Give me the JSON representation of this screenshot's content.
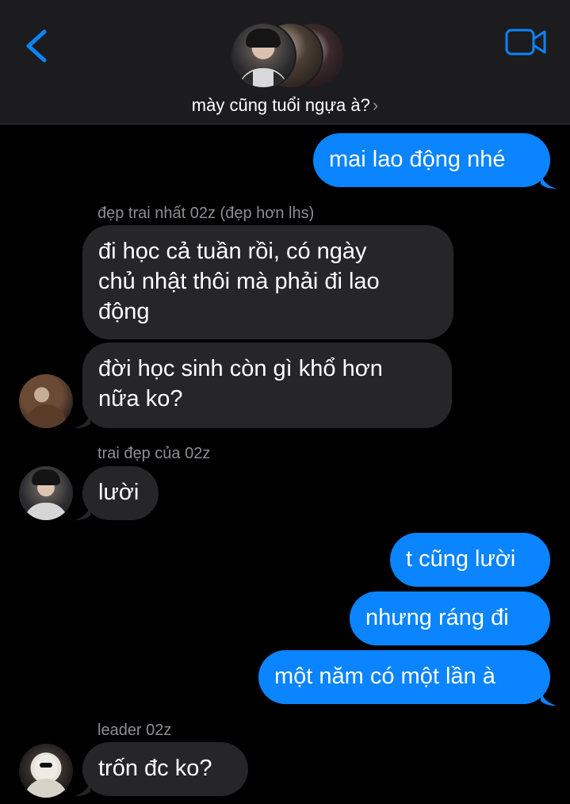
{
  "header": {
    "title": "mày cũng tuổi ngựa à?",
    "title_chevron": "›",
    "back_icon": "chevron-left-icon",
    "video_icon": "video-camera-icon",
    "accent_color": "#0a84ff"
  },
  "messages": [
    {
      "direction": "outgoing",
      "text": "mai lao động nhé"
    },
    {
      "sender": "đẹp trai nhất 02z (đẹp hơn lhs)"
    },
    {
      "direction": "incoming",
      "lines": [
        "đi học cả tuần rồi, có ngày",
        "chủ nhật thôi mà phải đi lao",
        "động"
      ]
    },
    {
      "direction": "incoming",
      "lines": [
        "đời học sinh còn gì khổ hơn",
        "nữa ko?"
      ]
    },
    {
      "sender": "trai đẹp của 02z"
    },
    {
      "direction": "incoming",
      "text": "lười"
    },
    {
      "direction": "outgoing",
      "text": "t cũng lười"
    },
    {
      "direction": "outgoing",
      "text": "nhưng ráng đi"
    },
    {
      "direction": "outgoing",
      "text": "một năm có một lần à"
    },
    {
      "sender": "leader 02z"
    },
    {
      "direction": "incoming",
      "text": "trốn đc ko?"
    }
  ],
  "colors": {
    "outgoing_bubble": "#0a84ff",
    "incoming_bubble": "#262628",
    "header_bg": "#1c1c1e",
    "sender_name": "#8e8e93"
  }
}
